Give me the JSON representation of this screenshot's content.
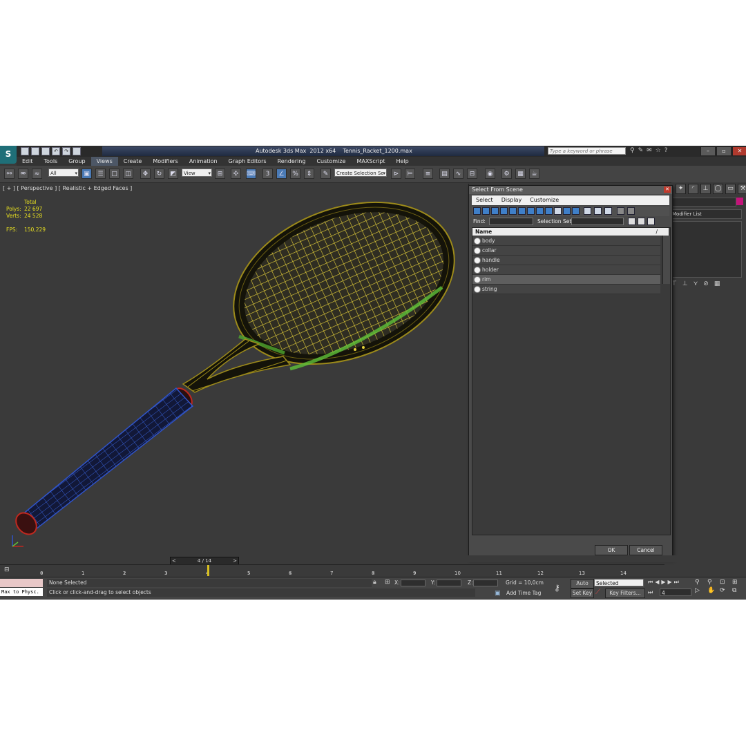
{
  "window": {
    "title": "Autodesk 3ds Max  2012 x64    Tennis_Racket_1200.max",
    "search_placeholder": "Type a keyword or phrase",
    "logo": "S"
  },
  "menu": [
    "Edit",
    "Tools",
    "Group",
    "Views",
    "Create",
    "Modifiers",
    "Animation",
    "Graph Editors",
    "Rendering",
    "Customize",
    "MAXScript",
    "Help"
  ],
  "toolbar": {
    "filter_value": "All",
    "refcoord_value": "View",
    "selection_set_placeholder": "Create Selection Se",
    "snap_label": "3"
  },
  "viewport": {
    "label": "[ + ] [ Perspective ] [ Realistic + Edged Faces ]",
    "stats": {
      "header": "Total",
      "polys_label": "Polys:",
      "polys_value": "22 697",
      "verts_label": "Verts:",
      "verts_value": "24 528",
      "fps_label": "FPS:",
      "fps_value": "150,229"
    }
  },
  "command_panel": {
    "modifier_list": "Modifier List"
  },
  "dialog": {
    "title": "Select From Scene",
    "menu": [
      "Select",
      "Display",
      "Customize"
    ],
    "find_label": "Find:",
    "selection_set_label": "Selection Set:",
    "column_header": "Name",
    "sort_indicator": "/",
    "items": [
      {
        "name": "body",
        "selected": false
      },
      {
        "name": "collar",
        "selected": false
      },
      {
        "name": "handle",
        "selected": false
      },
      {
        "name": "holder",
        "selected": false
      },
      {
        "name": "rim",
        "selected": true
      },
      {
        "name": "string",
        "selected": false
      }
    ],
    "ok_label": "OK",
    "cancel_label": "Cancel"
  },
  "timeline": {
    "slider_text": "4 / 14",
    "ticks": [
      "0",
      "1",
      "2",
      "3",
      "4",
      "5",
      "6",
      "7",
      "8",
      "9",
      "10",
      "11",
      "12",
      "13",
      "14"
    ]
  },
  "status": {
    "maxscript_text": "Max to Physc.",
    "selection_status": "None Selected",
    "prompt": "Click or click-and-drag to select objects",
    "x_label": "X:",
    "y_label": "Y:",
    "z_label": "Z:",
    "grid": "Grid = 10,0cm",
    "add_time_tag": "Add Time Tag",
    "auto_key": "Auto Key",
    "set_key": "Set Key",
    "selected_dd": "Selected",
    "key_filters": "Key Filters...",
    "frame": "4"
  },
  "colors": {
    "racket_mesh": "#c8a800",
    "strings": "#e6d13a",
    "grip": "#2f53c8",
    "highlight_green": "#5fc23a",
    "object_color": "#c4137a",
    "stats_text": "#e8e020"
  }
}
